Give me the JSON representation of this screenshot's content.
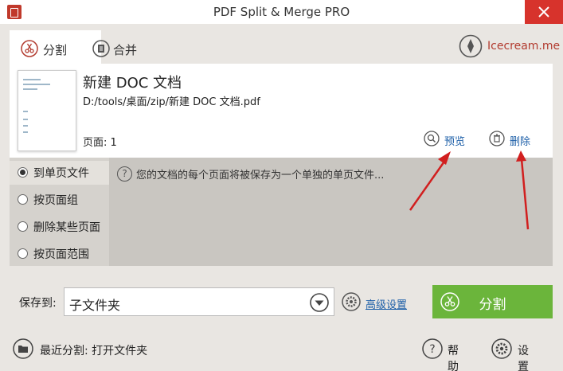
{
  "window": {
    "title": "PDF Split & Merge PRO"
  },
  "tabs": [
    {
      "label": "分割"
    },
    {
      "label": "合并"
    }
  ],
  "brand": {
    "label": "Icecream.me"
  },
  "document": {
    "name": "新建 DOC 文档",
    "path": "D:/tools/桌面/zip/新建 DOC 文档.pdf",
    "pages": "页面: 1"
  },
  "actions": {
    "preview": "预览",
    "delete": "删除"
  },
  "options": [
    {
      "label": "到单页文件",
      "selected": true
    },
    {
      "label": "按页面组",
      "selected": false
    },
    {
      "label": "删除某些页面",
      "selected": false
    },
    {
      "label": "按页面范围",
      "selected": false
    }
  ],
  "description": "您的文档的每个页面将被保存为一个单独的单页文件...",
  "save": {
    "label": "保存到:",
    "value": "子文件夹",
    "advanced": "高级设置"
  },
  "split_button": {
    "label": "分割"
  },
  "footer": {
    "recent": "最近分割: 打开文件夹",
    "help": "帮助",
    "settings": "设置"
  },
  "colors": {
    "accent": "#6bb53b",
    "link": "#1d5fa8",
    "brand": "#b23b2f",
    "close": "#d7332c",
    "arrow": "#d11f1f"
  }
}
